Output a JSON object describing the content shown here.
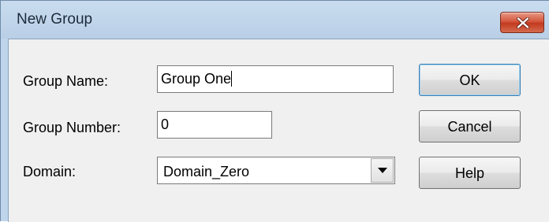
{
  "dialog": {
    "title": "New Group",
    "close_icon": "close-x-icon",
    "close_color": "#c8452b"
  },
  "form": {
    "group_name": {
      "label": "Group Name:",
      "value": "Group One"
    },
    "group_number": {
      "label": "Group Number:",
      "value": "0"
    },
    "domain": {
      "label": "Domain:",
      "value": "Domain_Zero",
      "arrow_icon": "dropdown-arrow-icon"
    }
  },
  "buttons": {
    "ok": "OK",
    "cancel": "Cancel",
    "help": "Help"
  }
}
